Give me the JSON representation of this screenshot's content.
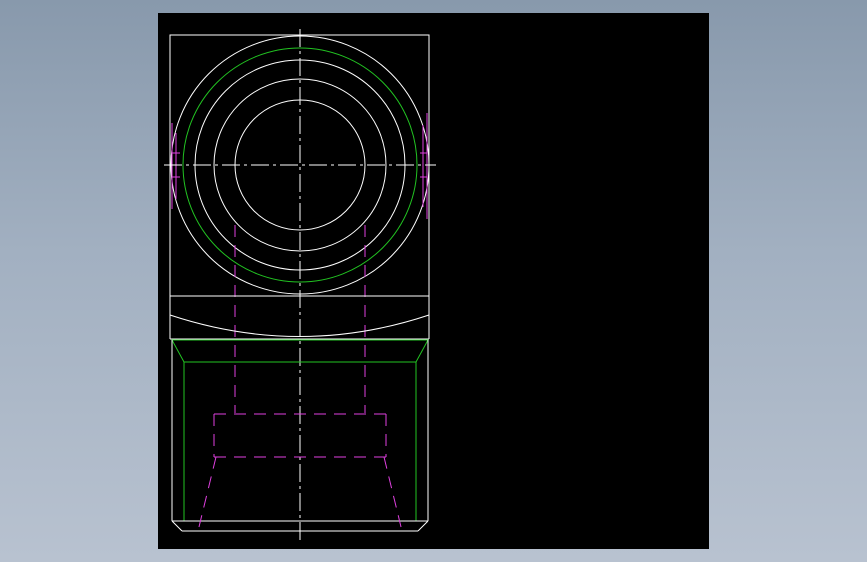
{
  "viewer": {
    "background_color": "#000000",
    "desktop_gradient": [
      "#8899ac",
      "#b8c2d0"
    ]
  },
  "drawing": {
    "line_colors": {
      "outline": "#ffffff",
      "thread": "#22c322",
      "hidden": "#e040e0",
      "centerline": "#ffffff"
    },
    "views": [
      {
        "name": "top-view",
        "content": [
          "outer-square",
          "concentric-circles",
          "thread-circle",
          "center-mark"
        ]
      },
      {
        "name": "front-view",
        "content": [
          "chamfered-body",
          "thread-edges",
          "hidden-bore",
          "centerline"
        ]
      }
    ]
  }
}
